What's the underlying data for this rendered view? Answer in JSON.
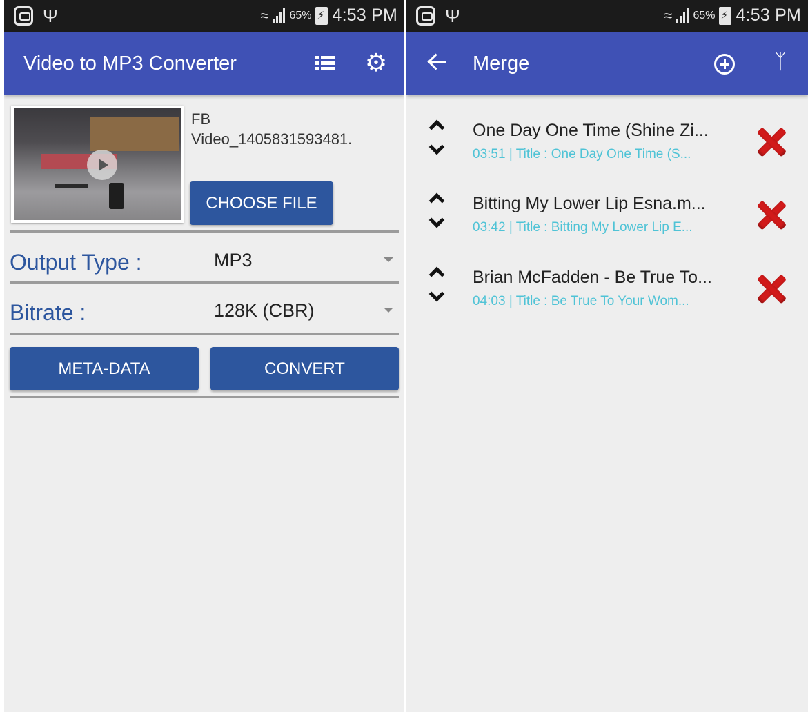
{
  "status_bar": {
    "battery": "65%",
    "time": "4:53 PM"
  },
  "converter": {
    "title": "Video to MP3 Converter",
    "file_name": "FB\nVideo_1405831593481.",
    "choose_file_label": "CHOOSE FILE",
    "output_type": {
      "label": "Output Type :",
      "value": "MP3"
    },
    "bitrate": {
      "label": "Bitrate :",
      "value": "128K (CBR)"
    },
    "meta_data_label": "META-DATA",
    "convert_label": "CONVERT",
    "icons": {
      "list": "list-icon",
      "settings": "gear-icon"
    }
  },
  "merge": {
    "title": "Merge",
    "icons": {
      "back": "back-arrow-icon",
      "add": "add-circle-icon",
      "merge": "merge-icon"
    },
    "items": [
      {
        "title": "One Day One Time (Shine Zi...",
        "subtitle": "03:51 | Title : One Day One Time (S..."
      },
      {
        "title": "Bitting My Lower Lip Esna.m...",
        "subtitle": "03:42 | Title : Bitting My Lower Lip E..."
      },
      {
        "title": "Brian McFadden - Be True To...",
        "subtitle": "04:03 | Title : Be True To Your Wom..."
      }
    ]
  },
  "colors": {
    "app_bar": "#3f51b5",
    "button": "#2d569e",
    "label": "#2d569e",
    "subtitle": "#4fc3d6",
    "remove": "#d11a1a"
  }
}
